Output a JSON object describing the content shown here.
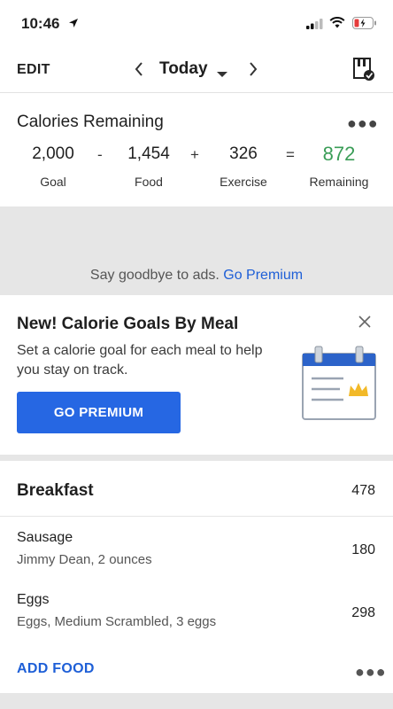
{
  "status_bar": {
    "time": "10:46"
  },
  "nav": {
    "edit_label": "EDIT",
    "date_label": "Today"
  },
  "calories": {
    "heading": "Calories Remaining",
    "goal_value": "2,000",
    "goal_label": "Goal",
    "food_value": "1,454",
    "food_label": "Food",
    "exercise_value": "326",
    "exercise_label": "Exercise",
    "remaining_value": "872",
    "remaining_label": "Remaining",
    "op_minus": "-",
    "op_plus": "+",
    "op_equals": "=",
    "remaining_color": "#3a9d57"
  },
  "ad": {
    "text": "Say goodbye to ads.",
    "link": "Go Premium"
  },
  "premium_card": {
    "title": "New! Calorie Goals By Meal",
    "description": "Set a calorie goal for each meal to help you stay on track.",
    "button_label": "GO PREMIUM",
    "button_color": "#2667e3",
    "close_icon": "close-icon",
    "illustration": "calendar-crown-icon"
  },
  "breakfast": {
    "title": "Breakfast",
    "total": "478",
    "items": [
      {
        "name": "Sausage",
        "detail": "Jimmy Dean, 2 ounces",
        "calories": "180"
      },
      {
        "name": "Eggs",
        "detail": "Eggs, Medium Scrambled, 3 eggs",
        "calories": "298"
      }
    ],
    "add_food_label": "ADD FOOD"
  }
}
